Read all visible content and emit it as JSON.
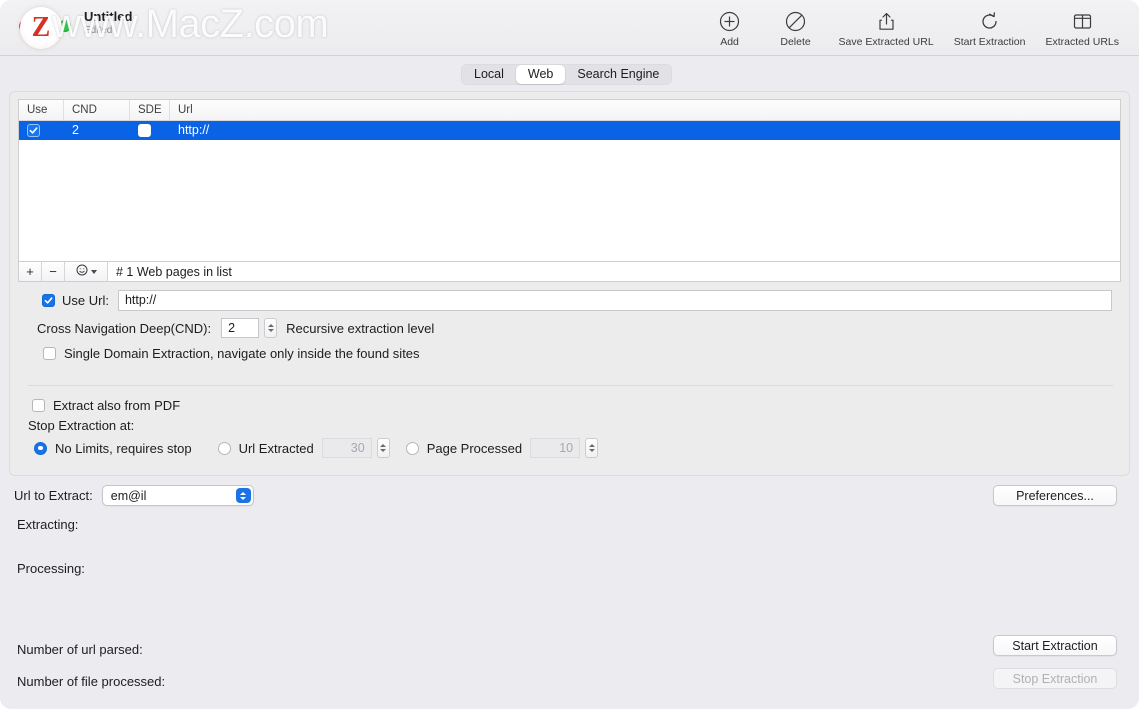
{
  "window": {
    "title": "Untitled",
    "subtitle": "Edited",
    "watermark": "www.MacZ.com",
    "watermark_logo": "Z"
  },
  "toolbar": {
    "items": [
      {
        "label": "Add",
        "icon": "plus-circle-icon"
      },
      {
        "label": "Delete",
        "icon": "prohibit-icon"
      },
      {
        "label": "Save Extracted URL",
        "icon": "share-upload-icon"
      },
      {
        "label": "Start Extraction",
        "icon": "refresh-icon"
      },
      {
        "label": "Extracted URLs",
        "icon": "columns-panel-icon"
      }
    ]
  },
  "tabs": {
    "items": [
      "Local",
      "Web",
      "Search Engine"
    ],
    "selected": "Web"
  },
  "table": {
    "columns": [
      "Use",
      "CND",
      "SDE",
      "Url"
    ],
    "rows": [
      {
        "use": true,
        "cnd": "2",
        "sde": false,
        "url": "http://",
        "selected": true
      }
    ]
  },
  "list_bar": {
    "add_label": "+",
    "remove_label": "−",
    "action_icon": "smiley-options-icon",
    "status": "# 1 Web pages in list"
  },
  "options": {
    "use_url_label": "Use Url:",
    "use_url_checked": true,
    "use_url_value": "http://",
    "cnd_label": "Cross Navigation Deep(CND):",
    "cnd_value": "2",
    "cnd_hint": "Recursive extraction level",
    "single_domain_label": "Single Domain Extraction, navigate only inside the found sites",
    "single_domain_checked": false,
    "pdf_label": "Extract also from PDF",
    "pdf_checked": false,
    "stop_at_label": "Stop Extraction at:",
    "stop_options": [
      {
        "label": "No Limits, requires stop",
        "selected": true
      },
      {
        "label": "Url Extracted",
        "selected": false,
        "value": "30"
      },
      {
        "label": "Page Processed",
        "selected": false,
        "value": "10"
      }
    ]
  },
  "bottom": {
    "url_to_extract_label": "Url to Extract:",
    "url_to_extract_value": "em@il",
    "preferences_label": "Preferences...",
    "extracting_label": "Extracting:",
    "processing_label": "Processing:",
    "url_parsed_label": "Number of url parsed:",
    "file_processed_label": "Number of file processed:",
    "start_label": "Start Extraction",
    "stop_label": "Stop Extraction"
  },
  "colors": {
    "accent": "#0a63e4",
    "window_bg": "#ececf0",
    "panel_bg": "#ececed"
  }
}
